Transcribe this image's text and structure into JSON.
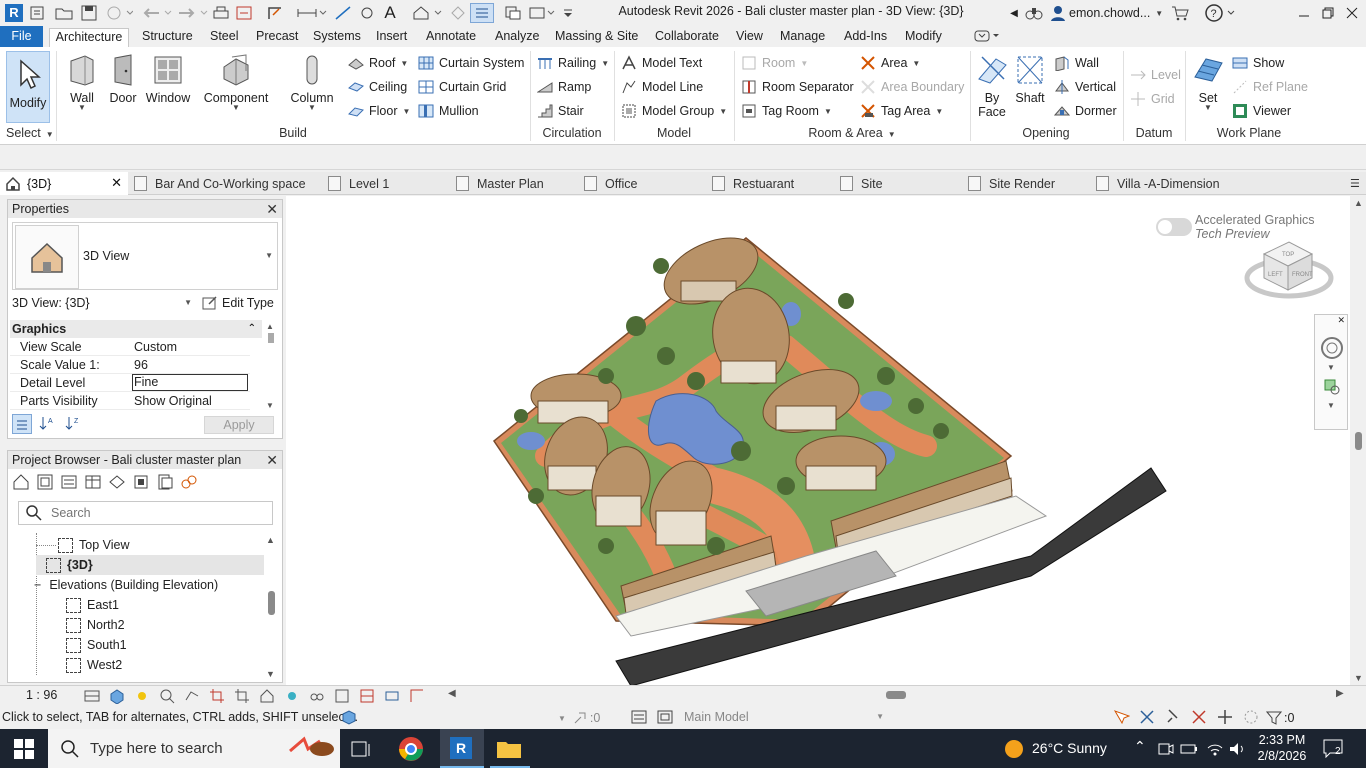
{
  "window": {
    "title": "Autodesk Revit 2026 - Bali cluster master plan - 3D View: {3D}",
    "user": "emon.chowd...",
    "app_badge": "R"
  },
  "ribbon_tabs": [
    "File",
    "Architecture",
    "Structure",
    "Steel",
    "Precast",
    "Systems",
    "Insert",
    "Annotate",
    "Analyze",
    "Massing & Site",
    "Collaborate",
    "View",
    "Manage",
    "Add-Ins",
    "Modify"
  ],
  "ribbon": {
    "select": {
      "modify": "Modify",
      "label": "Select"
    },
    "build": {
      "label": "Build",
      "wall": "Wall",
      "door": "Door",
      "window": "Window",
      "component": "Component",
      "column": "Column",
      "roof": "Roof",
      "ceiling": "Ceiling",
      "floor": "Floor",
      "curtain_system": "Curtain System",
      "curtain_grid": "Curtain Grid",
      "mullion": "Mullion"
    },
    "circulation": {
      "label": "Circulation",
      "railing": "Railing",
      "ramp": "Ramp",
      "stair": "Stair"
    },
    "model": {
      "label": "Model",
      "model_text": "Model Text",
      "model_line": "Model Line",
      "model_group": "Model Group"
    },
    "room_area": {
      "label": "Room & Area",
      "room": "Room",
      "room_separator": "Room Separator",
      "tag_room": "Tag Room",
      "area": "Area",
      "area_boundary": "Area Boundary",
      "tag_area": "Tag Area"
    },
    "opening": {
      "label": "Opening",
      "by_face": "By Face",
      "shaft": "Shaft",
      "wall": "Wall",
      "vertical": "Vertical",
      "dormer": "Dormer"
    },
    "datum": {
      "label": "Datum",
      "level": "Level",
      "grid": "Grid"
    },
    "work_plane": {
      "label": "Work Plane",
      "set": "Set",
      "show": "Show",
      "ref_plane": "Ref  Plane",
      "viewer": "Viewer"
    }
  },
  "view_tabs": [
    "{3D}",
    "Bar And Co-Working space",
    "Level 1",
    "Master Plan",
    "Office",
    "Restuarant",
    "Site",
    "Site Render",
    "Villa -A-Dimension"
  ],
  "properties": {
    "title": "Properties",
    "type_name": "3D View",
    "instance": "3D View: {3D}",
    "edit_type": "Edit Type",
    "section": "Graphics",
    "rows": [
      {
        "k": "View Scale",
        "v": "Custom"
      },
      {
        "k": "Scale Value    1:",
        "v": "96"
      },
      {
        "k": "Detail Level",
        "v": "Fine"
      },
      {
        "k": "Parts Visibility",
        "v": "Show Original"
      }
    ],
    "apply": "Apply"
  },
  "project_browser": {
    "title": "Project Browser - Bali cluster master plan",
    "search_placeholder": "Search",
    "items": [
      {
        "label": "Top View"
      },
      {
        "label": "{3D}"
      },
      {
        "label": "Elevations (Building Elevation)"
      },
      {
        "label": "East1"
      },
      {
        "label": "North2"
      },
      {
        "label": "South1"
      },
      {
        "label": "West2"
      }
    ]
  },
  "canvas": {
    "accel_title": "Accelerated Graphics",
    "accel_sub": "Tech Preview",
    "viewcube_top": "TOP",
    "viewcube_left": "LEFT",
    "viewcube_front": "FRONT"
  },
  "view_control": {
    "scale": "1 : 96"
  },
  "status": {
    "hint": "Click to select, TAB for alternates, CTRL adds, SHIFT unselects.",
    "count1": ":0",
    "model": "Main Model",
    "count2": ":0"
  },
  "taskbar": {
    "search": "Type here to search",
    "weather": "26°C  Sunny",
    "time": "2:33 PM",
    "date": "2/8/2026",
    "notif": "2"
  }
}
